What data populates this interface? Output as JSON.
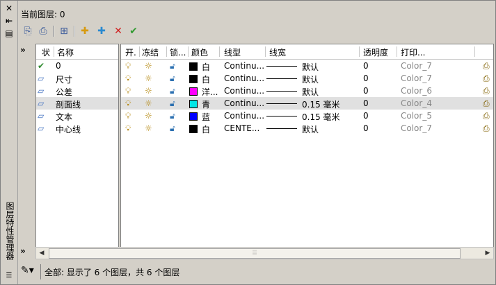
{
  "palette_title": "图层特性管理器",
  "current_layer": {
    "label": "当前图层: 0"
  },
  "side_buttons": {
    "close": "✕",
    "autohide": "⇤",
    "props": "▤"
  },
  "toolbar": {
    "new_prop_filter": "⎘",
    "new_group_filter": "⎙",
    "layer_states": "⊞",
    "new_layer": "✚",
    "new_layer_frozen": "✚",
    "delete_layer": "✕",
    "set_current": "✔"
  },
  "filter_pane": {
    "collapse": "»",
    "expand": "»"
  },
  "columns": {
    "status": "状",
    "name": "名称",
    "on": "开.",
    "freeze": "冻结",
    "lock": "锁...",
    "color": "颜色",
    "linetype": "线型",
    "lineweight": "线宽",
    "transparency": "透明度",
    "plot_style": "打印..."
  },
  "layers": [
    {
      "status": "current",
      "name": "0",
      "color_hex": "#000000",
      "color_name": "白",
      "linetype": "Continu...",
      "lineweight": "默认",
      "transparency": "0",
      "plot_style": "Color_7"
    },
    {
      "status": "layer",
      "name": "尺寸",
      "color_hex": "#000000",
      "color_name": "白",
      "linetype": "Continu...",
      "lineweight": "默认",
      "transparency": "0",
      "plot_style": "Color_7"
    },
    {
      "status": "layer",
      "name": "公差",
      "color_hex": "#ff00ff",
      "color_name": "洋...",
      "linetype": "Continu...",
      "lineweight": "默认",
      "transparency": "0",
      "plot_style": "Color_6"
    },
    {
      "status": "layer",
      "name": "剖面线",
      "color_hex": "#00e5e5",
      "color_name": "青",
      "linetype": "Continu...",
      "lineweight": "0.15 毫米",
      "transparency": "0",
      "plot_style": "Color_4",
      "selected": true
    },
    {
      "status": "layer",
      "name": "文本",
      "color_hex": "#0000ff",
      "color_name": "蓝",
      "linetype": "Continu...",
      "lineweight": "0.15 毫米",
      "transparency": "0",
      "plot_style": "Color_5"
    },
    {
      "status": "layer",
      "name": "中心线",
      "color_hex": "#000000",
      "color_name": "白",
      "linetype": "CENTE...",
      "lineweight": "默认",
      "transparency": "0",
      "plot_style": "Color_7"
    }
  ],
  "scrollbar": {
    "left": "◀",
    "right": "▶",
    "grip": "⦙⦙⦙"
  },
  "status_bar": {
    "text": "全部: 显示了 6 个图层，共 6 个图层"
  }
}
